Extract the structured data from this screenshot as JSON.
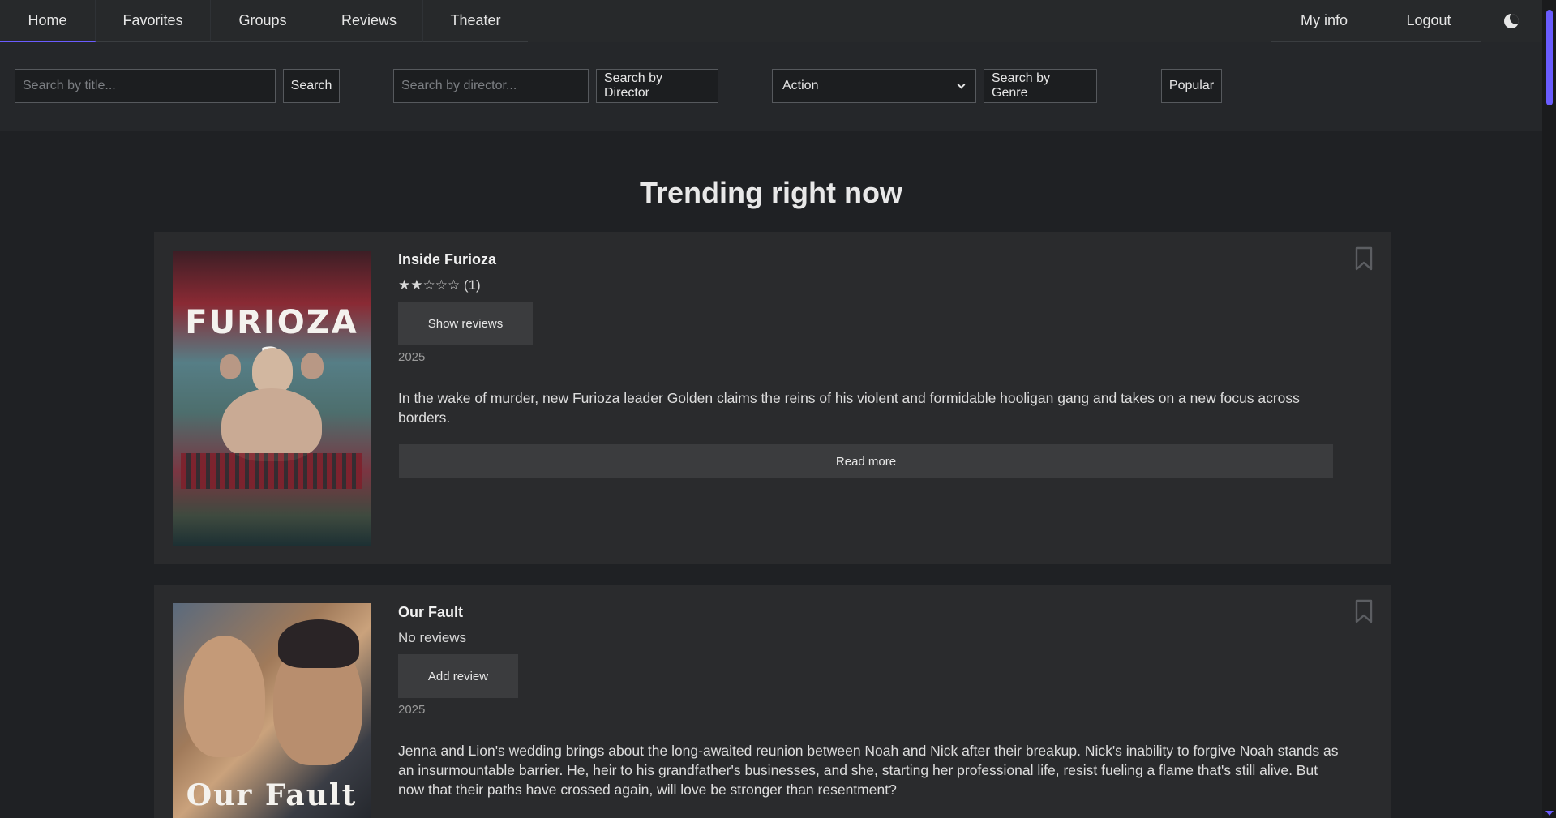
{
  "nav": {
    "home": "Home",
    "favorites": "Favorites",
    "groups": "Groups",
    "reviews": "Reviews",
    "theater": "Theater",
    "my_info": "My info",
    "logout": "Logout",
    "theme_icon": "moon-icon"
  },
  "search": {
    "title_placeholder": "Search by title...",
    "title_button": "Search",
    "director_placeholder": "Search by director...",
    "director_button": "Search by Director",
    "genre_selected": "Action",
    "genre_button": "Search by Genre",
    "popular_button": "Popular"
  },
  "main": {
    "heading": "Trending right now"
  },
  "movies": [
    {
      "title": "Inside Furioza",
      "rating_text": "★★☆☆☆ (1)",
      "action_label": "Show reviews",
      "year": "2025",
      "description": "In the wake of murder, new Furioza leader Golden claims the reins of his violent and formidable hooligan gang and takes on a new focus across borders.",
      "read_more": "Read more",
      "poster_text": "FURIOZA 2"
    },
    {
      "title": "Our Fault",
      "rating_text": "No reviews",
      "action_label": "Add review",
      "year": "2025",
      "description": "Jenna and Lion's wedding brings about the long-awaited reunion between Noah and Nick after their breakup. Nick's inability to forgive Noah stands as an insurmountable barrier. He, heir to his grandfather's businesses, and she, starting her professional life, resist fueling a flame that's still alive. But now that their paths have crossed again, will love be stronger than resentment?",
      "poster_text": "Our Fault"
    }
  ],
  "colors": {
    "accent": "#6a5cff",
    "background": "#1f2124",
    "card": "#2a2b2d"
  }
}
